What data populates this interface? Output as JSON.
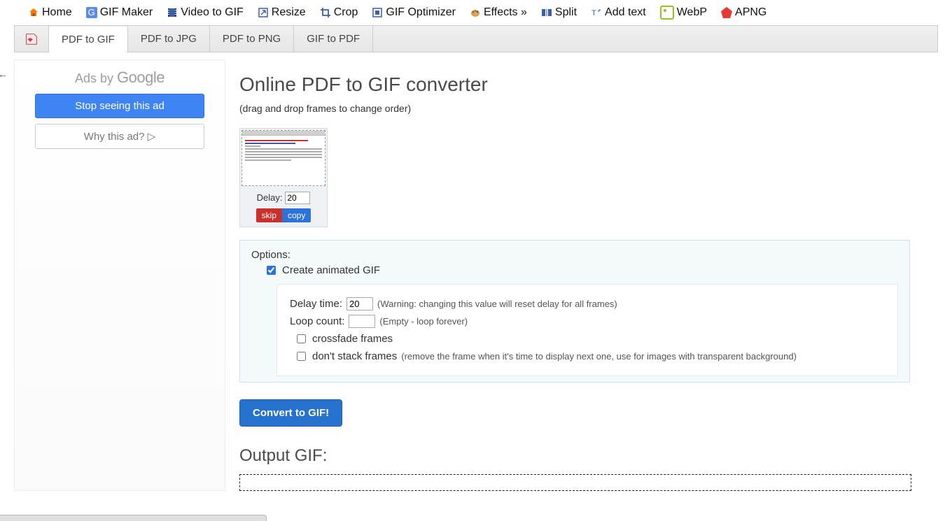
{
  "topnav": [
    {
      "label": "Home",
      "icon": "home-icon"
    },
    {
      "label": "GIF Maker",
      "icon": "gifmaker-icon"
    },
    {
      "label": "Video to GIF",
      "icon": "video-icon"
    },
    {
      "label": "Resize",
      "icon": "resize-icon"
    },
    {
      "label": "Crop",
      "icon": "crop-icon"
    },
    {
      "label": "GIF Optimizer",
      "icon": "optimizer-icon"
    },
    {
      "label": "Effects »",
      "icon": "effects-icon"
    },
    {
      "label": "Split",
      "icon": "split-icon"
    },
    {
      "label": "Add text",
      "icon": "addtext-icon"
    },
    {
      "label": "WebP",
      "icon": "webp-icon"
    },
    {
      "label": "APNG",
      "icon": "apng-icon"
    }
  ],
  "subtabs": [
    {
      "label": "PDF to GIF",
      "active": true
    },
    {
      "label": "PDF to JPG",
      "active": false
    },
    {
      "label": "PDF to PNG",
      "active": false
    },
    {
      "label": "GIF to PDF",
      "active": false
    }
  ],
  "ads": {
    "head_prefix": "Ads by ",
    "head_brand": "Google",
    "stop": "Stop seeing this ad",
    "why": "Why this ad? ▷"
  },
  "page": {
    "title": "Online PDF to GIF converter",
    "subtitle": "(drag and drop frames to change order)"
  },
  "frame": {
    "delay_label": "Delay:",
    "delay_value": "20",
    "skip": "skip",
    "copy": "copy"
  },
  "options": {
    "head": "Options:",
    "animated_label": "Create animated GIF",
    "animated_checked": true,
    "delay_label": "Delay time:",
    "delay_value": "20",
    "delay_hint": "(Warning: changing this value will reset delay for all frames)",
    "loop_label": "Loop count:",
    "loop_value": "",
    "loop_hint": "(Empty - loop forever)",
    "crossfade_label": "crossfade frames",
    "crossfade_checked": false,
    "stack_label": "don't stack frames",
    "stack_hint": "(remove the frame when it's time to display next one, use for images with transparent background)",
    "stack_checked": false
  },
  "convert_label": "Convert to GIF!",
  "output_title": "Output GIF:"
}
